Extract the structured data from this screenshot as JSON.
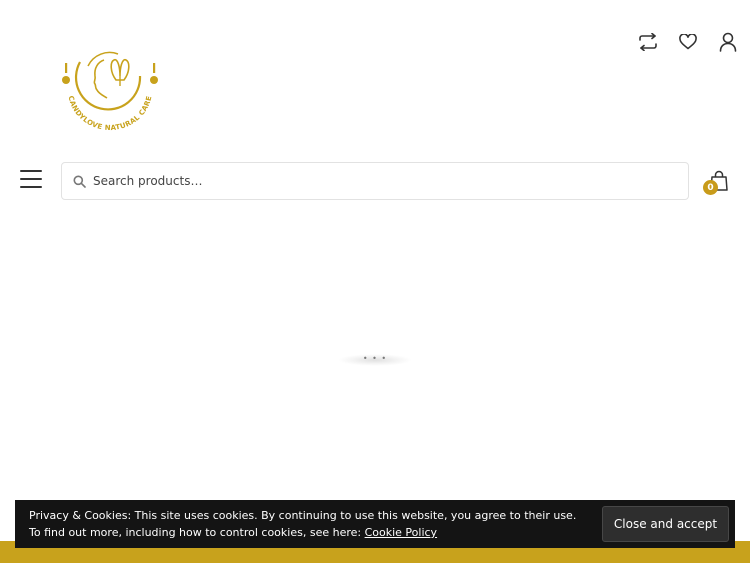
{
  "header": {
    "icons": [
      "compare-icon",
      "wishlist-heart-icon",
      "account-user-icon"
    ],
    "logo": {
      "text": "CANDYLOVE NATURAL CARE",
      "color": "#c8a21c"
    }
  },
  "search": {
    "placeholder": "Search products…",
    "value": ""
  },
  "cart": {
    "count": "0",
    "badge_color": "#c89b1a"
  },
  "loader": {
    "dots": "• • •"
  },
  "cookie_notice": {
    "line1": "Privacy & Cookies: This site uses cookies. By continuing to use this website, you agree to their use.",
    "line2_prefix": "To find out more, including how to control cookies, see here: ",
    "policy_link": "Cookie Policy",
    "accept_label": "Close and accept"
  },
  "colors": {
    "accent_gold": "#c8a21c",
    "cookie_bg": "#141414"
  }
}
